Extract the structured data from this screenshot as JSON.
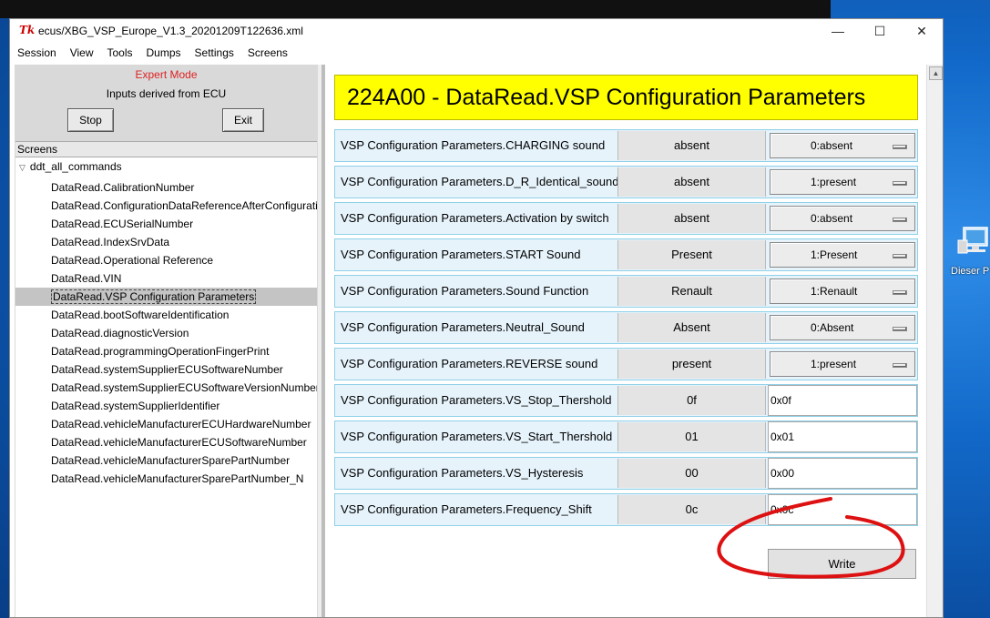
{
  "window": {
    "title": "ecus/XBG_VSP_Europe_V1.3_20201209T122636.xml",
    "app_icon_text": "Tk",
    "min_glyph": "—",
    "max_glyph": "☐",
    "close_glyph": "✕"
  },
  "menu": [
    "Session",
    "View",
    "Tools",
    "Dumps",
    "Settings",
    "Screens"
  ],
  "left": {
    "mode": "Expert Mode",
    "info": "Inputs derived from ECU",
    "stop_label": "Stop",
    "exit_label": "Exit",
    "tree_header": "Screens",
    "tree_root": "ddt_all_commands",
    "items": [
      "DataRead.CalibrationNumber",
      "DataRead.ConfigurationDataReferenceAfterConfigurati",
      "DataRead.ECUSerialNumber",
      "DataRead.IndexSrvData",
      "DataRead.Operational Reference",
      "DataRead.VIN",
      "DataRead.VSP Configuration Parameters",
      "DataRead.bootSoftwareIdentification",
      "DataRead.diagnosticVersion",
      "DataRead.programmingOperationFingerPrint",
      "DataRead.systemSupplierECUSoftwareNumber",
      "DataRead.systemSupplierECUSoftwareVersionNumber",
      "DataRead.systemSupplierIdentifier",
      "DataRead.vehicleManufacturerECUHardwareNumber",
      "DataRead.vehicleManufacturerECUSoftwareNumber",
      "DataRead.vehicleManufacturerSparePartNumber",
      "DataRead.vehicleManufacturerSparePartNumber_N"
    ],
    "selected_index": 6
  },
  "screen": {
    "header": "224A00 - DataRead.VSP Configuration Parameters",
    "params": [
      {
        "label": "VSP Configuration Parameters.CHARGING sound",
        "value": "absent",
        "control": "select",
        "setting": "0:absent"
      },
      {
        "label": "VSP Configuration Parameters.D_R_Identical_sound",
        "value": "absent",
        "control": "select",
        "setting": "1:present"
      },
      {
        "label": "VSP Configuration Parameters.Activation by switch",
        "value": "absent",
        "control": "select",
        "setting": "0:absent"
      },
      {
        "label": "VSP Configuration Parameters.START Sound",
        "value": "Present",
        "control": "select",
        "setting": "1:Present"
      },
      {
        "label": "VSP Configuration Parameters.Sound Function",
        "value": "Renault",
        "control": "select",
        "setting": "1:Renault"
      },
      {
        "label": "VSP Configuration Parameters.Neutral_Sound",
        "value": "Absent",
        "control": "select",
        "setting": "0:Absent"
      },
      {
        "label": "VSP Configuration Parameters.REVERSE sound",
        "value": "present",
        "control": "select",
        "setting": "1:present"
      },
      {
        "label": "VSP Configuration Parameters.VS_Stop_Thershold",
        "value": "0f",
        "control": "input",
        "setting": "0x0f"
      },
      {
        "label": "VSP Configuration Parameters.VS_Start_Thershold",
        "value": "01",
        "control": "input",
        "setting": "0x01"
      },
      {
        "label": "VSP Configuration Parameters.VS_Hysteresis",
        "value": "00",
        "control": "input",
        "setting": "0x00"
      },
      {
        "label": "VSP Configuration Parameters.Frequency_Shift",
        "value": "0c",
        "control": "input",
        "setting": "0x0c"
      }
    ],
    "write_label": "Write"
  },
  "desktop": {
    "icon_label": "Dieser P"
  },
  "colors": {
    "header_bg": "#ffff00",
    "row_bg": "#e6f3fb",
    "row_border": "#8fd0e8",
    "expert_mode": "#dd2222",
    "annotation": "#dd1111"
  }
}
